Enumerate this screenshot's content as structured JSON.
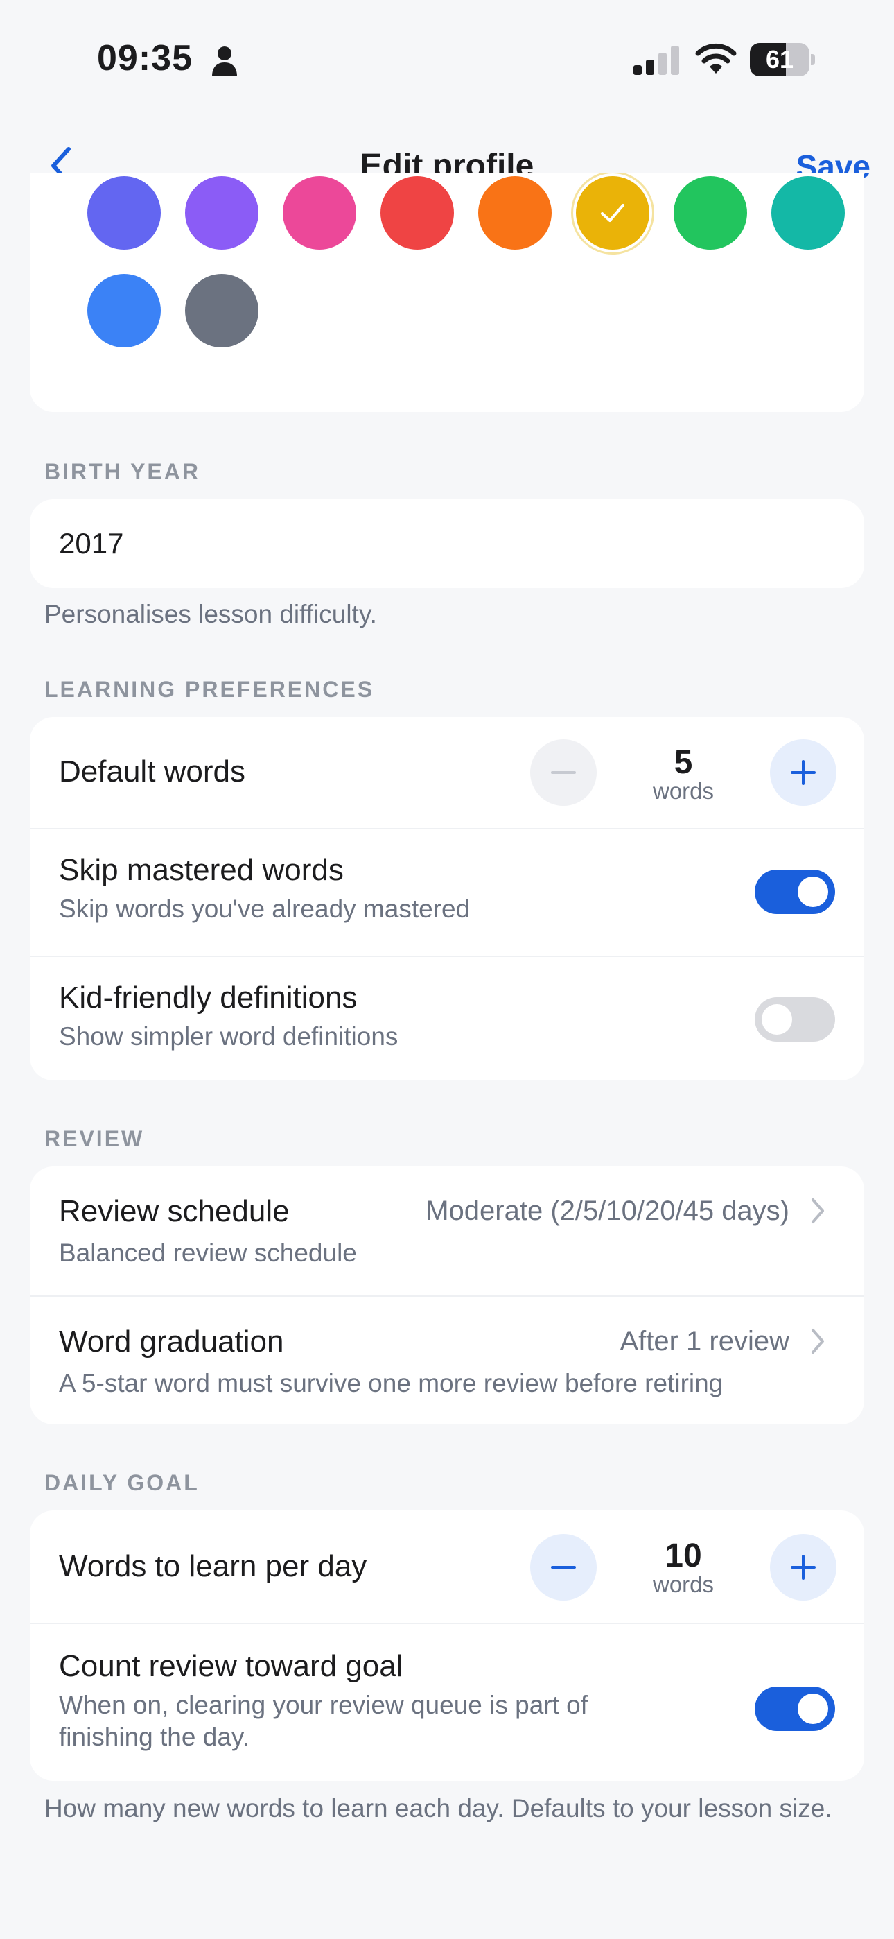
{
  "status_bar": {
    "time": "09:35",
    "battery": "61",
    "battery_level": 0.61
  },
  "nav": {
    "title": "Edit profile",
    "save_label": "Save"
  },
  "colors": {
    "swatches": [
      "#6366f1",
      "#8b5cf6",
      "#ec4899",
      "#ef4444",
      "#f97316",
      "#eab308",
      "#22c55e",
      "#14b8a6",
      "#3b82f6",
      "#6b7280"
    ],
    "selected": "#eab308"
  },
  "birth_year": {
    "label": "BIRTH YEAR",
    "value": "2017",
    "helper": "Personalises lesson difficulty."
  },
  "learning": {
    "label": "LEARNING PREFERENCES",
    "default_words": {
      "title": "Default words",
      "value": "5",
      "unit": "words"
    },
    "skip_mastered": {
      "title": "Skip mastered words",
      "subtitle": "Skip words you've already mastered",
      "on": true
    },
    "kid_friendly": {
      "title": "Kid-friendly definitions",
      "subtitle": "Show simpler word definitions",
      "on": false
    }
  },
  "review": {
    "label": "REVIEW",
    "schedule": {
      "title": "Review schedule",
      "value": "Moderate (2/5/10/20/45 days)",
      "subtitle": "Balanced review schedule"
    },
    "graduation": {
      "title": "Word graduation",
      "value": "After 1 review",
      "subtitle": "A 5-star word must survive one more review before retiring"
    }
  },
  "daily_goal": {
    "label": "DAILY GOAL",
    "words_per_day": {
      "title": "Words to learn per day",
      "value": "10",
      "unit": "words"
    },
    "count_review": {
      "title": "Count review toward goal",
      "subtitle": "When on, clearing your review queue is part of finishing the day.",
      "on": true
    },
    "helper": "How many new words to learn each day. Defaults to your lesson size."
  },
  "theme": {
    "accent": "#1a5fdc",
    "background": "#f6f7f9"
  }
}
